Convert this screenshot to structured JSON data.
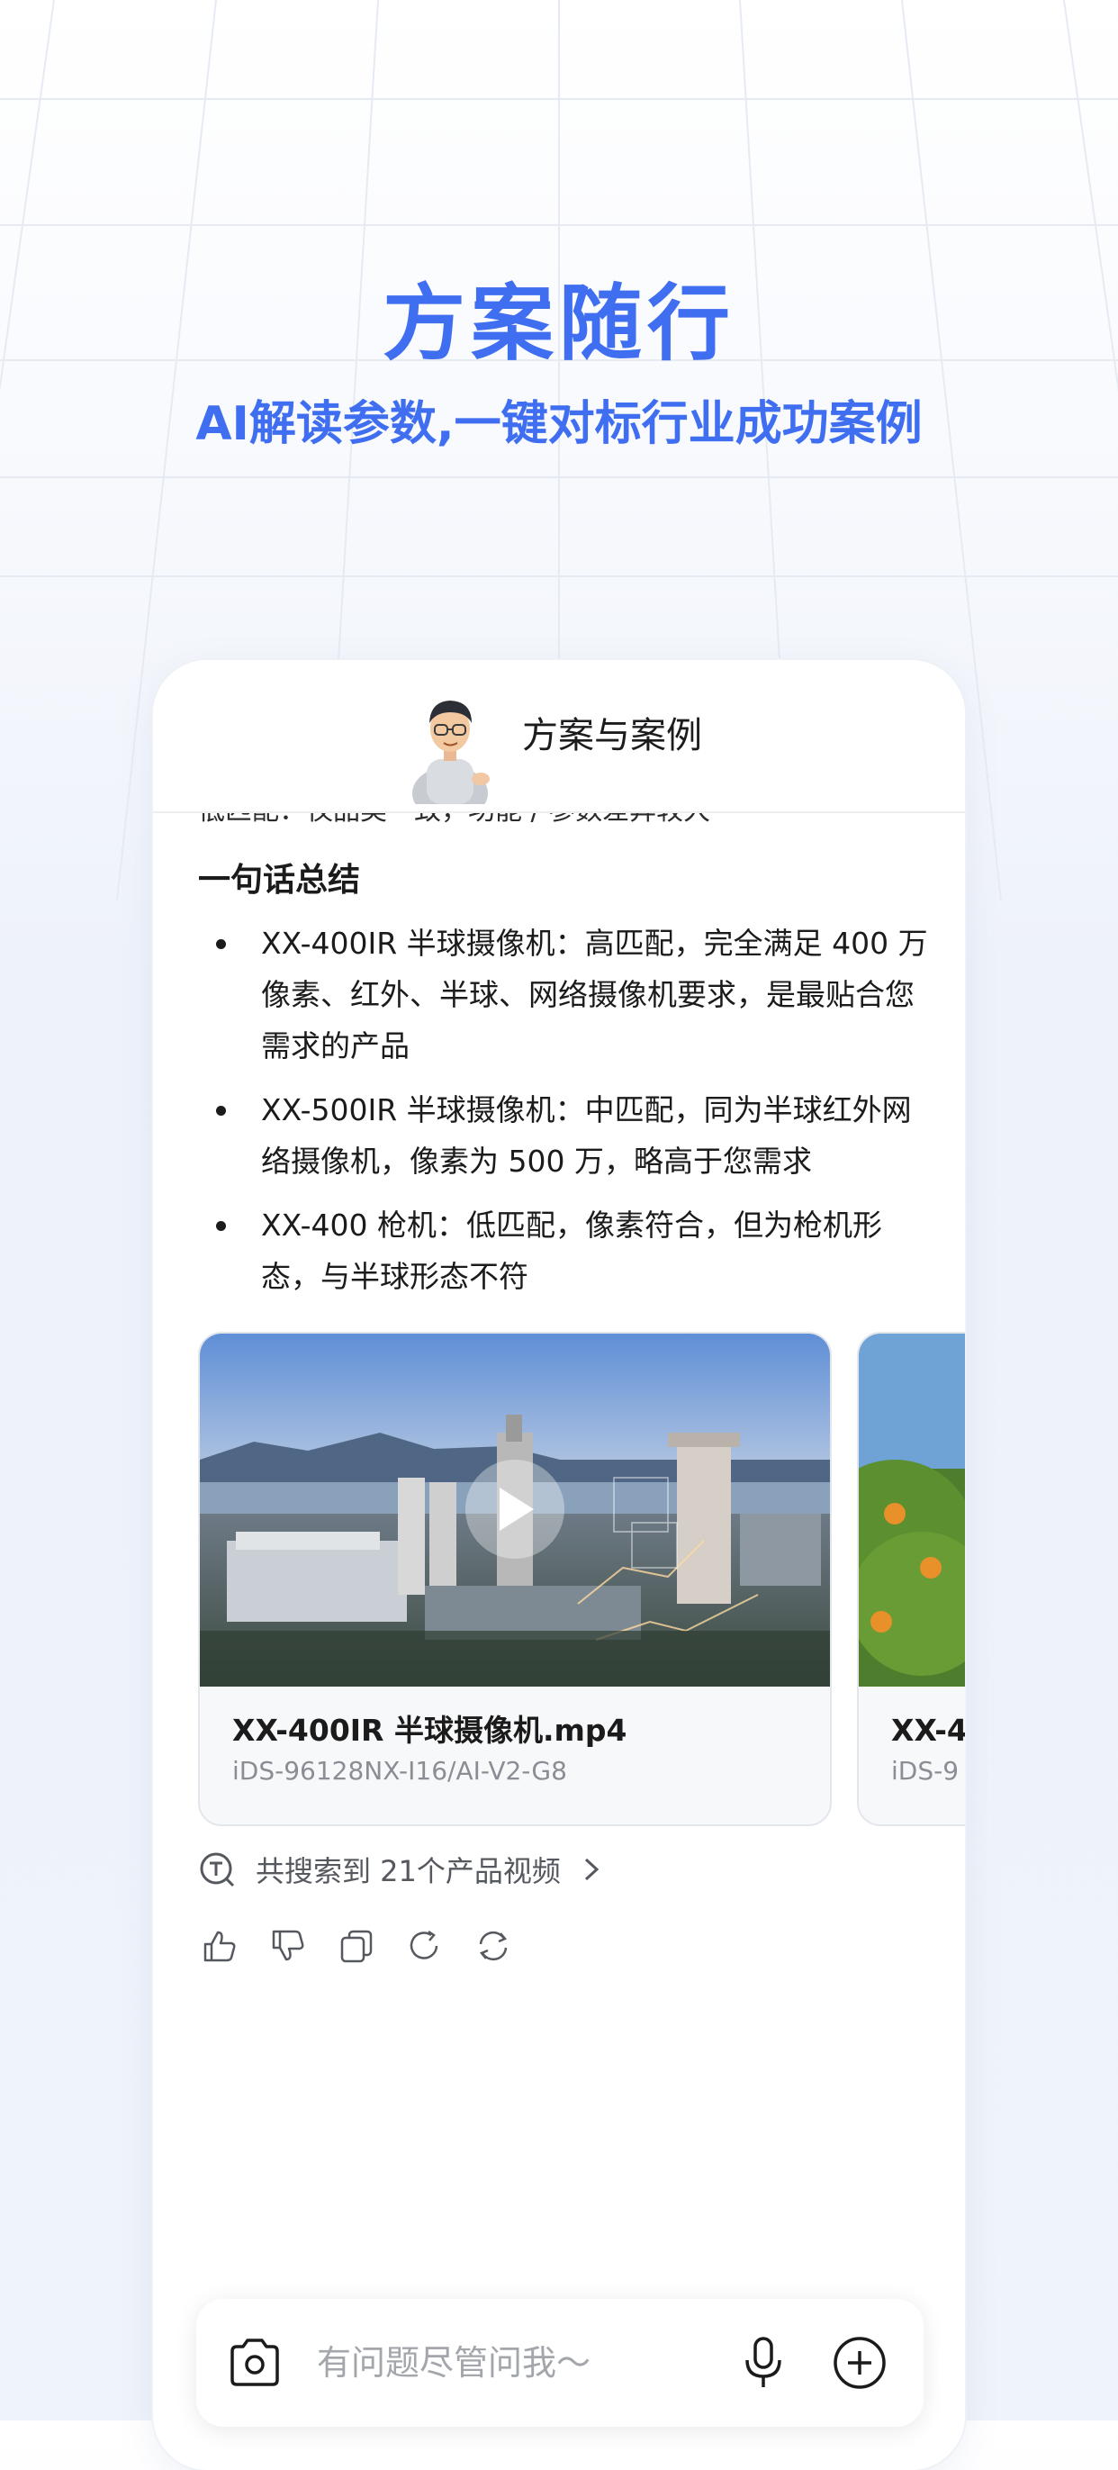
{
  "hero": {
    "title": "方案随行",
    "subtitle": "AI解读参数,一键对标行业成功案例"
  },
  "chat": {
    "header_title": "方案与案例",
    "cut_text": "低匹配：仅品类一致，功能 / 参数差异较大",
    "summary_title": "一句话总结",
    "bullets": [
      "XX-400IR 半球摄像机：高匹配，完全满足 400 万像素、红外、半球、网络摄像机要求，是最贴合您需求的产品",
      "XX-500IR 半球摄像机：中匹配，同为半球红外网络摄像机，像素为 500 万，略高于您需求",
      "XX-400 枪机：低匹配，像素符合，但为枪机形态，与半球形态不符"
    ],
    "videos": [
      {
        "title": "XX-400IR 半球摄像机.mp4",
        "model": "iDS-96128NX-I16/AI-V2-G8"
      },
      {
        "title": "XX-4",
        "model": "iDS-9"
      }
    ],
    "search_summary": "共搜索到 21个产品视频",
    "actions": [
      "thumb-up-icon",
      "thumb-down-icon",
      "copy-icon",
      "regenerate-icon",
      "refresh-icon"
    ]
  },
  "input": {
    "placeholder": "有问题尽管问我～"
  },
  "colors": {
    "accent": "#3f6ef0",
    "text": "#1b1b1b",
    "muted": "#8a8d93"
  }
}
